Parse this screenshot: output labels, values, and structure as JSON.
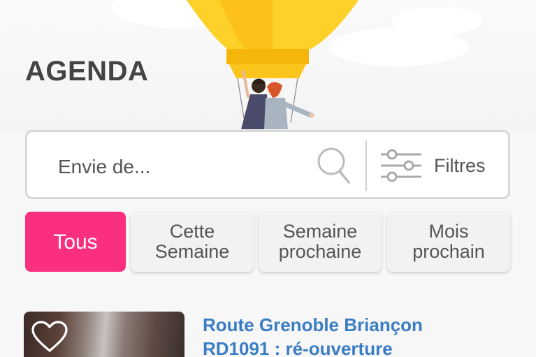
{
  "header": {
    "title": "AGENDA",
    "illustration": "hot-air-balloon-illustration"
  },
  "search": {
    "placeholder": "Envie de...",
    "search_icon": "search-icon",
    "filter_icon": "sliders-icon",
    "filter_label": "Filtres"
  },
  "tabs": [
    {
      "label": "Tous",
      "active": true
    },
    {
      "label": "Cette\nSemaine",
      "active": false
    },
    {
      "label": "Semaine\nprochaine",
      "active": false
    },
    {
      "label": "Mois\nprochain",
      "active": false
    }
  ],
  "events": [
    {
      "title": "Route Grenoble Briançon\nRD1091 : ré-ouverture",
      "favorite_icon": "heart-icon"
    }
  ],
  "colors": {
    "accent": "#fb2f7f",
    "link": "#3b7dc4",
    "balloon": "#fcc820",
    "text": "#444444"
  }
}
